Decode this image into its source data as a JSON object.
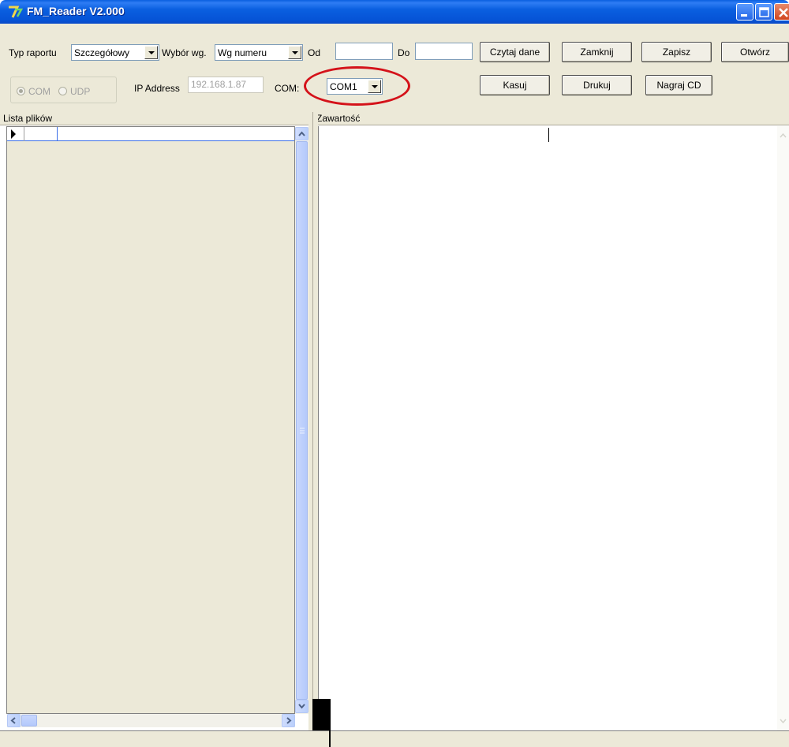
{
  "window": {
    "title": "FM_Reader V2.000"
  },
  "toolbar": {
    "typ_label": "Typ raportu",
    "typ_value": "Szczegółowy",
    "wybor_label": "Wybór wg.",
    "wybor_value": "Wg numeru",
    "od_label": "Od",
    "od_value": "",
    "do_label": "Do",
    "do_value": "",
    "btn_czytaj": "Czytaj dane",
    "btn_zamknij": "Zamknij",
    "btn_zapisz": "Zapisz",
    "btn_otworz": "Otwórz",
    "radio_com": "COM",
    "radio_udp": "UDP",
    "ip_label": "IP Address",
    "ip_value": "192.168.1.87",
    "com_label": "COM:",
    "com_value": "COM1",
    "btn_kasuj": "Kasuj",
    "btn_drukuj": "Drukuj",
    "btn_nagraj": "Nagraj CD"
  },
  "panes": {
    "left_header": "Lista plików",
    "right_header": "Zawartość"
  },
  "colors": {
    "titlebar": "#0a5fe0",
    "panel": "#ece9d8",
    "highlight": "#d4121a"
  }
}
